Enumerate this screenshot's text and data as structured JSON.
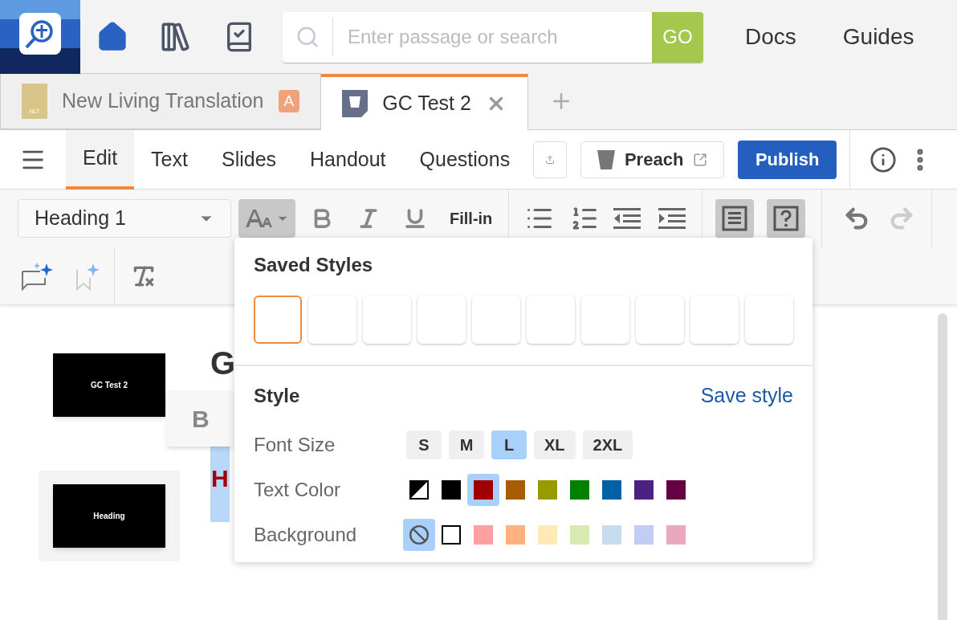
{
  "top_nav": {
    "search": {
      "placeholder": "Enter passage or search",
      "button": "GO"
    },
    "links": [
      "Docs",
      "Guides"
    ]
  },
  "doc_tabs": [
    {
      "title": "New Living Translation",
      "icon_text": "NLT",
      "badge": "A",
      "selected": false,
      "closable": false
    },
    {
      "title": "GC Test 2",
      "selected": true,
      "closable": true
    }
  ],
  "toolbar": {
    "tabs": [
      {
        "label": "Edit",
        "selected": true
      },
      {
        "label": "Text",
        "selected": false
      },
      {
        "label": "Slides",
        "selected": false
      },
      {
        "label": "Handout",
        "selected": false
      },
      {
        "label": "Questions",
        "selected": false
      }
    ],
    "preach": "Preach",
    "publish": "Publish"
  },
  "format_toolbar": {
    "block_style": "Heading 1",
    "text_style_open": true,
    "fill_in": "Fill-in",
    "toggles": [
      {
        "kind": "text",
        "selected": true
      },
      {
        "kind": "question",
        "selected": true
      }
    ]
  },
  "slides": [
    {
      "label": "GC Test 2",
      "selected": false
    },
    {
      "label": "Heading",
      "selected": true
    }
  ],
  "document": {
    "heading": "G",
    "highlighted": "H"
  },
  "floating_toolbar": {
    "bold": "B"
  },
  "popover": {
    "title": "Saved Styles",
    "saved_styles": [
      {
        "selected": true
      },
      {
        "selected": false
      },
      {
        "selected": false
      },
      {
        "selected": false
      },
      {
        "selected": false
      },
      {
        "selected": false
      },
      {
        "selected": false
      },
      {
        "selected": false
      },
      {
        "selected": false
      },
      {
        "selected": false
      }
    ],
    "style_title": "Style",
    "save_link": "Save style",
    "font_size": {
      "label": "Font Size",
      "options": [
        {
          "label": "S",
          "selected": false
        },
        {
          "label": "M",
          "selected": false
        },
        {
          "label": "L",
          "selected": true
        },
        {
          "label": "XL",
          "selected": false
        },
        {
          "label": "2XL",
          "selected": false
        }
      ]
    },
    "text_color": {
      "label": "Text Color",
      "swatches": [
        {
          "kind": "auto",
          "selected": false
        },
        {
          "kind": "color",
          "color": "#000000",
          "selected": false
        },
        {
          "kind": "color",
          "color": "#a00000",
          "selected": true
        },
        {
          "kind": "color",
          "color": "#a65e00",
          "selected": false
        },
        {
          "kind": "color",
          "color": "#999900",
          "selected": false
        },
        {
          "kind": "color",
          "color": "#008000",
          "selected": false
        },
        {
          "kind": "color",
          "color": "#0060a8",
          "selected": false
        },
        {
          "kind": "color",
          "color": "#4d2084",
          "selected": false
        },
        {
          "kind": "color",
          "color": "#660044",
          "selected": false
        }
      ]
    },
    "background": {
      "label": "Background",
      "swatches": [
        {
          "kind": "none",
          "selected": true
        },
        {
          "kind": "color",
          "color": "#ffffff",
          "selected": false
        },
        {
          "kind": "color",
          "color": "#ff9f9f",
          "selected": false
        },
        {
          "kind": "color",
          "color": "#ffb27f",
          "selected": false
        },
        {
          "kind": "color",
          "color": "#ffeab5",
          "selected": false
        },
        {
          "kind": "color",
          "color": "#d8eab0",
          "selected": false
        },
        {
          "kind": "color",
          "color": "#c8dcf0",
          "selected": false
        },
        {
          "kind": "color",
          "color": "#c2ccf5",
          "selected": false
        },
        {
          "kind": "color",
          "color": "#eaa8c0",
          "selected": false
        }
      ]
    }
  }
}
